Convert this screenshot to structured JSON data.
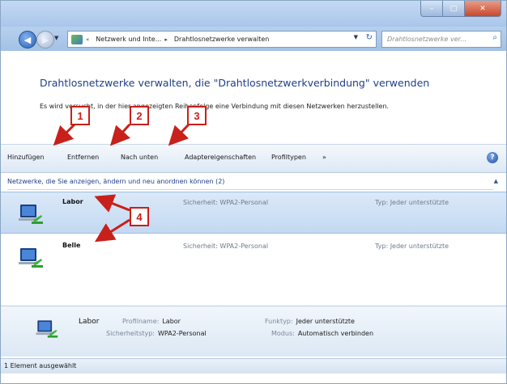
{
  "window": {
    "caption_buttons": {
      "minimize": "–",
      "maximize": "□",
      "close": "✕"
    }
  },
  "address_bar": {
    "crumb_1": "Netzwerk und Inte...",
    "crumb_2": "Drahtlosnetzwerke verwalten",
    "separator": "▸",
    "search_placeholder": "Drahtlosnetzwerke ver..."
  },
  "page": {
    "heading": "Drahtlosnetzwerke verwalten, die \"Drahtlosnetzwerkverbindung\" verwenden",
    "description": "Es wird versucht, in der hier angezeigten Reihenfolge eine Verbindung mit diesen Netzwerken herzustellen."
  },
  "toolbar": {
    "add": "Hinzufügen",
    "remove": "Entfernen",
    "move_down": "Nach unten",
    "adapter_properties": "Adaptereigenschaften",
    "profile_types": "Profiltypen",
    "more": "»",
    "help": "?"
  },
  "group": {
    "header": "Netzwerke, die Sie anzeigen, ändern und neu anordnen können (2)",
    "caret": "▲"
  },
  "networks": [
    {
      "name": "Labor",
      "security": "Sicherheit: WPA2-Personal",
      "type": "Typ: Jeder unterstützte",
      "selected": true
    },
    {
      "name": "Belle",
      "security": "Sicherheit: WPA2-Personal",
      "type": "Typ: Jeder unterstützte",
      "selected": false
    }
  ],
  "details": {
    "name": "Labor",
    "profile_name_label": "Profilname:",
    "profile_name_value": "Labor",
    "security_type_label": "Sicherheitstyp:",
    "security_type_value": "WPA2-Personal",
    "radio_type_label": "Funktyp:",
    "radio_type_value": "Jeder unterstützte",
    "mode_label": "Modus:",
    "mode_value": "Automatisch verbinden"
  },
  "status_bar": {
    "text": "1 Element ausgewählt"
  },
  "annotations": {
    "b1": "1",
    "b2": "2",
    "b3": "3",
    "b4": "4",
    "color": "#c8201b"
  }
}
